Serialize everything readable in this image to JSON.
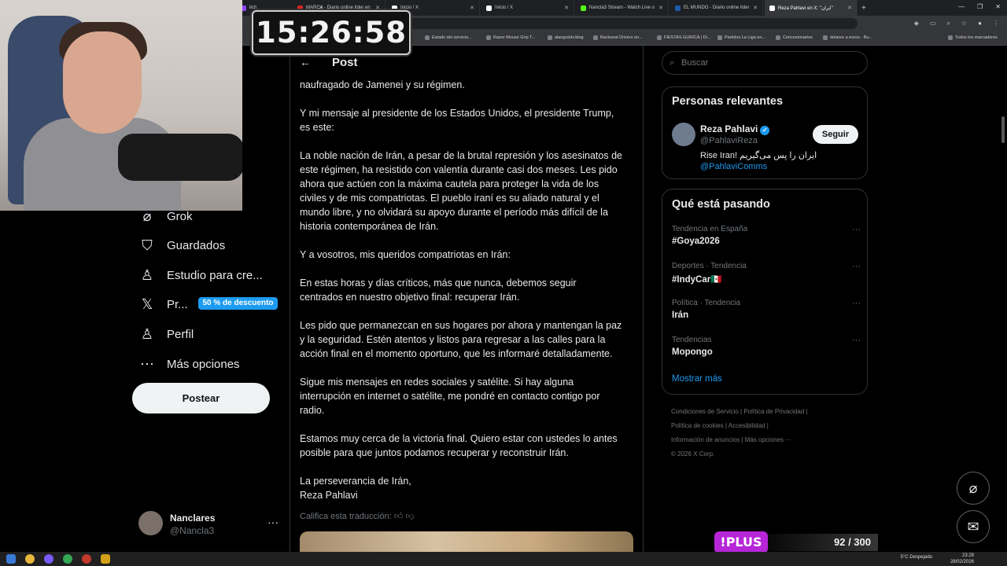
{
  "browser": {
    "tabs": [
      {
        "label": "itch",
        "color": "#9146ff"
      },
      {
        "label": "MARCA - Diario online líder en",
        "color": "#d6281f"
      },
      {
        "label": "Inicio / X",
        "color": "#ffffff"
      },
      {
        "label": "Inicio / X",
        "color": "#ffffff"
      },
      {
        "label": "Nancla3 Stream - Watch Live o",
        "color": "#53fc18"
      },
      {
        "label": "EL MUNDO - Diario online líder",
        "color": "#1d5aa8"
      },
      {
        "label": "Reza Pahlavi en X: \"ایران\"",
        "color": "#ffffff"
      }
    ],
    "bookmarks": [
      "Estado del servicio...",
      "Razer Mouse Grip T...",
      "alangulotv.blog",
      "Backseat Drivers en...",
      "FIESTAS GURICA | Di...",
      "Partidos La Liga en...",
      "Concesionarios",
      "dolares a euros - Bu...",
      "Todos los marcadores"
    ]
  },
  "clock": "15:26:58",
  "nav": {
    "items": [
      {
        "label": "Grok",
        "icon": "grok-icon",
        "glyph": "⌀"
      },
      {
        "label": "Guardados",
        "icon": "bookmark-icon",
        "glyph": "⛉"
      },
      {
        "label": "Estudio para cre...",
        "icon": "creator-studio-icon",
        "glyph": "♙"
      },
      {
        "label": "Pr...",
        "icon": "x-premium-icon",
        "glyph": "𝕏"
      },
      {
        "label": "Perfil",
        "icon": "profile-icon",
        "glyph": "♙"
      },
      {
        "label": "Más opciones",
        "icon": "more-options-icon",
        "glyph": "⋯"
      }
    ],
    "promo_badge": "50 % de descuento",
    "post_button": "Postear",
    "account": {
      "name": "Nanclares",
      "handle": "@Nancla3"
    }
  },
  "post": {
    "header_title": "Post",
    "paragraphs": [
      "naufragado de Jamenei y su régimen.",
      "Y mi mensaje al presidente de los Estados Unidos, el presidente Trump,\nes este:",
      "La noble nación de Irán, a pesar de la brutal represión y los asesinatos de\neste régimen, ha resistido con valentía durante casi dos meses. Les pido\nahora que actúen con la máxima cautela para proteger la vida de los\nciviles y de mis compatriotas. El pueblo iraní es su aliado natural y el\nmundo libre, y no olvidará su apoyo durante el período más difícil de la\nhistoria contemporánea de Irán.",
      "Y a vosotros, mis queridos compatriotas en Irán:",
      "En estas horas y días críticos, más que nunca, debemos seguir\ncentrados en nuestro objetivo final: recuperar Irán.",
      "Les pido que permanezcan en sus hogares por ahora y mantengan la paz\ny la seguridad. Estén atentos y listos para regresar a las calles para la\nacción final en el momento oportuno, que les informaré detalladamente.",
      "Sigue mis mensajes en redes sociales y satélite. Si hay alguna\ninterrupción en internet o satélite, me pondré en contacto contigo por\nradio.",
      "Estamos muy cerca de la victoria final. Quiero estar con ustedes lo antes\nposible para que juntos podamos recuperar y reconstruir Irán.",
      "La perseverancia de Irán,\nReza Pahlavi"
    ],
    "rate_translation": "Califica esta traducción:"
  },
  "sidebar": {
    "search_placeholder": "Buscar",
    "relevant": {
      "title": "Personas relevantes",
      "name": "Reza Pahlavi",
      "handle": "@PahlaviReza",
      "bio": "Rise Iran! ایران را پس می‌گیریم",
      "bio_link": "@PahlaviComms",
      "follow": "Seguir"
    },
    "trends": {
      "title": "Qué está pasando",
      "items": [
        {
          "category": "Tendencia en España",
          "topic": "#Goya2026"
        },
        {
          "category": "Deportes · Tendencia",
          "topic": "#IndyCar🇲🇽"
        },
        {
          "category": "Política · Tendencia",
          "topic": "Irán"
        },
        {
          "category": "Tendencias",
          "topic": "Mopongo"
        }
      ],
      "show_more": "Mostrar más"
    },
    "footer": [
      "Condiciones de Servicio   |   Política de Privacidad   |",
      "Política de cookies   |   Accesibilidad   |",
      "Información de anuncios   |   Más opciones ···",
      "© 2026 X Corp."
    ]
  },
  "overlay": {
    "plus_label": "!PLUS",
    "plus_count": "92 / 300"
  },
  "taskbar": {
    "weather": "5°C  Despejado",
    "time": "23:29",
    "date": "28/02/2026"
  }
}
